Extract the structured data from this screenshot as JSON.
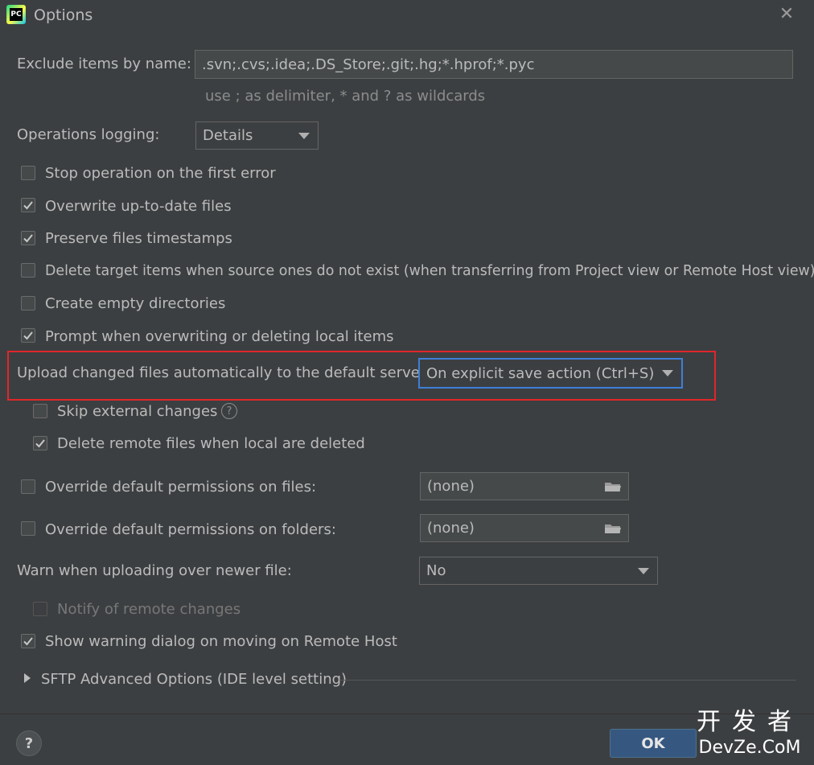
{
  "window": {
    "title": "Options",
    "app_icon_text": "PC"
  },
  "exclude": {
    "label": "Exclude items by name:",
    "value": ".svn;.cvs;.idea;.DS_Store;.git;.hg;*.hprof;*.pyc",
    "hint": "use ; as delimiter, * and ? as wildcards"
  },
  "logging": {
    "label": "Operations logging:",
    "value": "Details"
  },
  "checkboxes": {
    "stop_on_error": {
      "label": "Stop operation on the first error",
      "checked": false
    },
    "overwrite_up_to_date": {
      "label": "Overwrite up-to-date files",
      "checked": true
    },
    "preserve_timestamps": {
      "label": "Preserve files timestamps",
      "checked": true
    },
    "delete_target_items": {
      "label": "Delete target items when source ones do not exist (when transferring from Project view or Remote Host view)",
      "checked": false
    },
    "create_empty_dirs": {
      "label": "Create empty directories",
      "checked": false
    },
    "prompt_overwriting": {
      "label": "Prompt when overwriting or deleting local items",
      "checked": true
    },
    "skip_external": {
      "label": "Skip external changes",
      "checked": false
    },
    "delete_remote": {
      "label": "Delete remote files when local are deleted",
      "checked": true
    },
    "override_files": {
      "label": "Override default permissions on files:",
      "checked": false
    },
    "override_folders": {
      "label": "Override default permissions on folders:",
      "checked": false
    },
    "notify_remote": {
      "label": "Notify of remote changes",
      "checked": false,
      "disabled": true
    },
    "show_warning_dialog": {
      "label": "Show warning dialog on moving on Remote Host",
      "checked": true
    }
  },
  "upload": {
    "label": "Upload changed files automatically to the default server",
    "value": "On explicit save action (Ctrl+S)"
  },
  "permissions": {
    "files_value": "(none)",
    "folders_value": "(none)"
  },
  "warn_newer": {
    "label": "Warn when uploading over newer file:",
    "value": "No"
  },
  "sftp": {
    "label": "SFTP Advanced Options (IDE level setting)"
  },
  "footer": {
    "help_label": "?",
    "ok_label": "OK"
  },
  "watermark": {
    "line1": "开发者",
    "line2": "DevZe.CoM"
  },
  "colors": {
    "highlight": "#e0262b",
    "focus": "#3d7fd8",
    "ok_button": "#365880",
    "background": "#3c3f41"
  }
}
